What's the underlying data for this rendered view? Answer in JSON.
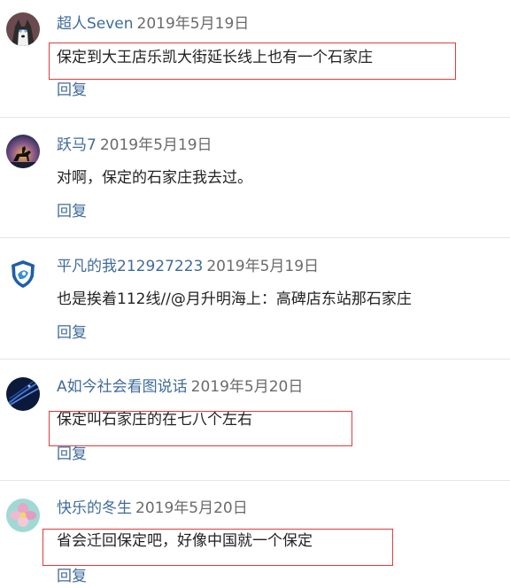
{
  "comments": [
    {
      "username": "超人Seven",
      "date": "2019年5月19日",
      "text": "保定到大王店乐凯大街延长线上也有一个石家庄",
      "reply_label": "回复",
      "avatar_icon": "husky-dog-avatar-icon"
    },
    {
      "username": "跃马7",
      "date": "2019年5月19日",
      "text": "对啊，保定的石家庄我去过。",
      "reply_label": "回复",
      "avatar_icon": "horse-rider-silhouette-avatar-icon"
    },
    {
      "username": "平凡的我212927223",
      "date": "2019年5月19日",
      "text": "也是挨着112线//@月升明海上：高碑店东站那石家庄",
      "reply_label": "回复",
      "avatar_icon": "shield-badge-avatar-icon"
    },
    {
      "username": "A如今社会看图说话",
      "date": "2019年5月20日",
      "text": "保定叫石家庄的在七八个左右",
      "reply_label": "回复",
      "avatar_icon": "dark-blue-swirl-avatar-icon"
    },
    {
      "username": "快乐的冬生",
      "date": "2019年5月20日",
      "text": "省会迁回保定吧，好像中国就一个保定",
      "reply_label": "回复",
      "avatar_icon": "flower-avatar-icon"
    }
  ],
  "colors": {
    "username": "#3f6b9c",
    "date": "#6b6b6b",
    "text": "#222222",
    "divider": "#e6e6e6",
    "highlight": "#e23b3b"
  }
}
